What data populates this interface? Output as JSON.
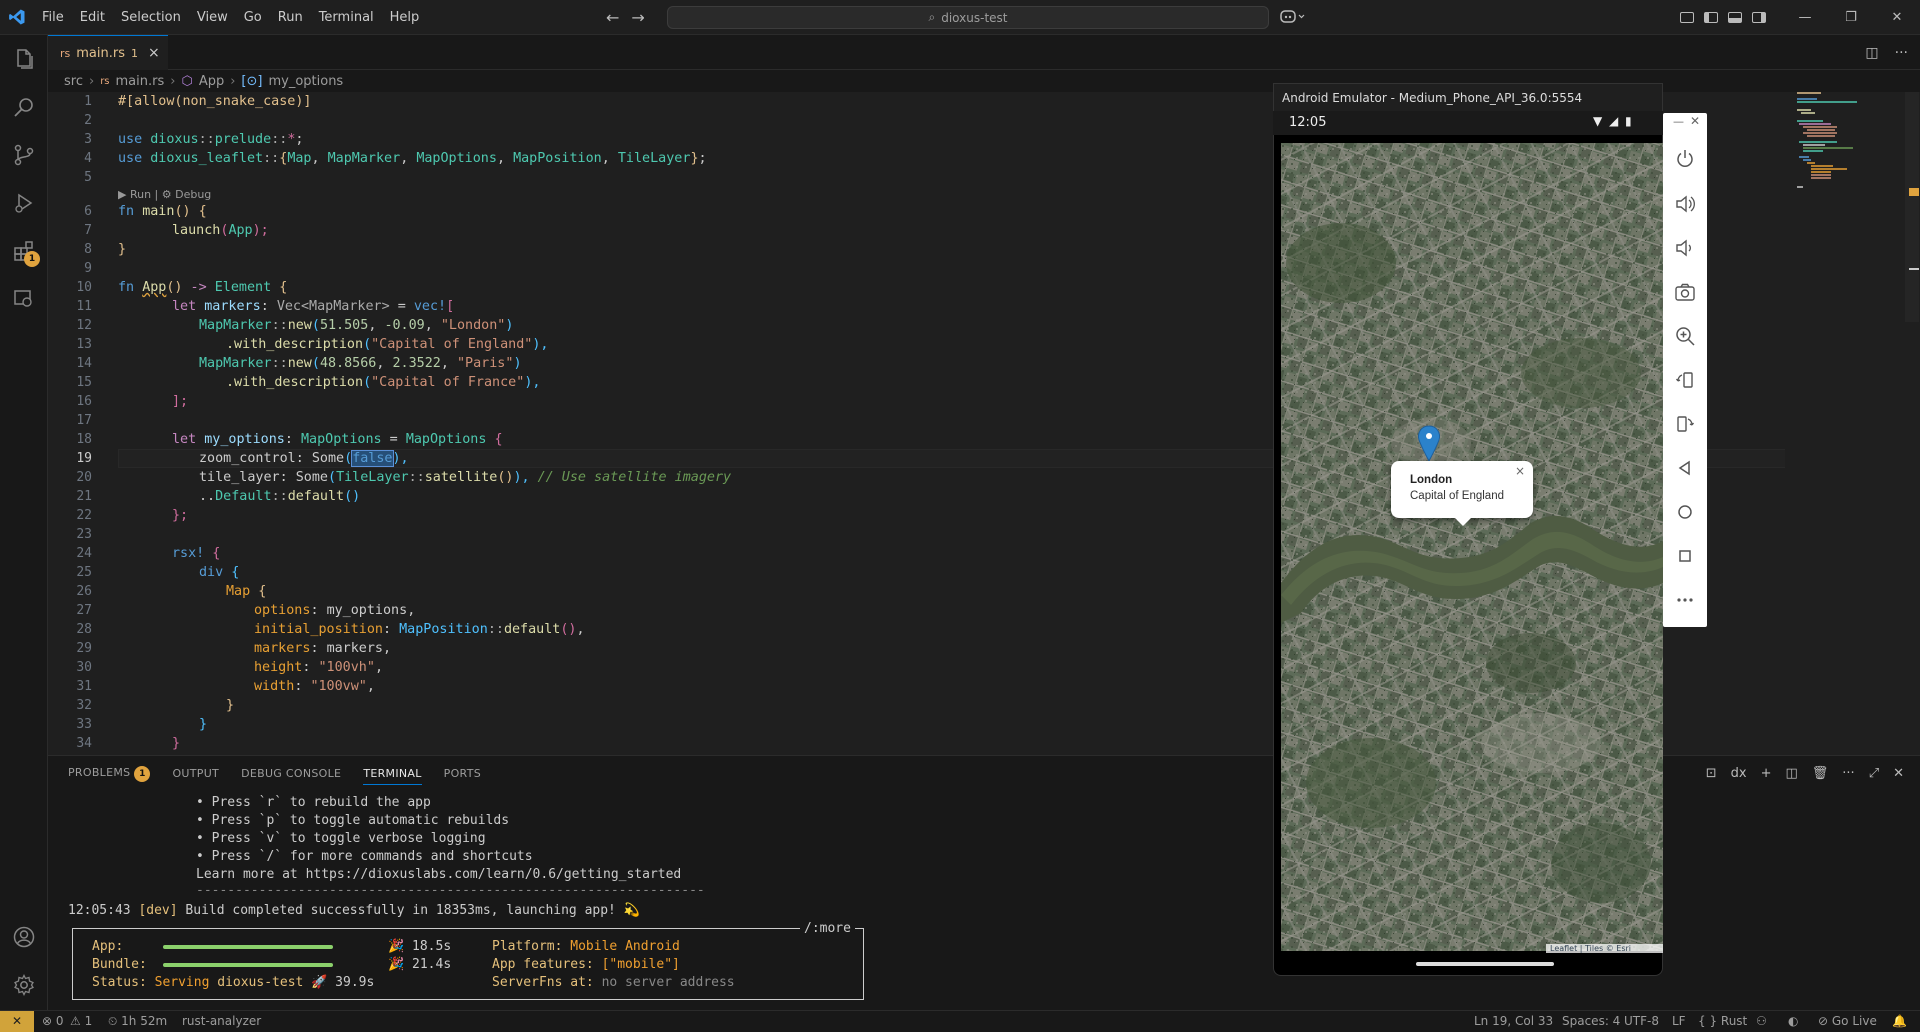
{
  "titlebar": {
    "menu": [
      "File",
      "Edit",
      "Selection",
      "View",
      "Go",
      "Run",
      "Terminal",
      "Help"
    ],
    "search": "dioxus-test"
  },
  "tab": {
    "icon_text": "rs",
    "name": "main.rs",
    "problems": "1",
    "close": "×"
  },
  "breadcrumb": [
    "src",
    "main.rs",
    "App",
    "my_options"
  ],
  "codelens": "▶ Run | ⚙ Debug",
  "line_numbers": [
    "1",
    "2",
    "3",
    "4",
    "5",
    "6",
    "7",
    "8",
    "9",
    "10",
    "11",
    "12",
    "13",
    "14",
    "15",
    "16",
    "17",
    "18",
    "19",
    "20",
    "21",
    "22",
    "23",
    "24",
    "25",
    "26",
    "27",
    "28",
    "29",
    "30",
    "31",
    "32",
    "33",
    "34"
  ],
  "code": {
    "l1": [
      "#[allow(non_snake_case)]"
    ],
    "l3": [
      "use",
      "dioxus",
      "::",
      "prelude",
      "::",
      "*",
      ";"
    ],
    "l4": [
      "use",
      "dioxus_leaflet",
      "::",
      "{",
      "Map",
      ", ",
      "MapMarker",
      ", ",
      "MapOptions",
      ", ",
      "MapPosition",
      ", ",
      "TileLayer",
      "}",
      ";"
    ],
    "l6": [
      "fn",
      "main",
      "()",
      " {"
    ],
    "l7": [
      "launch",
      "(",
      "App",
      ");"
    ],
    "l8": [
      "}"
    ],
    "l10": [
      "fn",
      "App",
      "()",
      " -> ",
      "Element",
      " {"
    ],
    "l11": [
      "let",
      "markers",
      ": ",
      "Vec<MapMarker>",
      " = ",
      "vec!",
      "["
    ],
    "l12": [
      "MapMarker",
      "::",
      "new",
      "(",
      "51.505",
      ", ",
      "-0.09",
      ", ",
      "\"London\"",
      ")"
    ],
    "l13": [
      ".with_description",
      "(",
      "\"Capital of England\"",
      "),"
    ],
    "l14": [
      "MapMarker",
      "::",
      "new",
      "(",
      "48.8566",
      ", ",
      "2.3522",
      ", ",
      "\"Paris\"",
      ")"
    ],
    "l15": [
      ".with_description",
      "(",
      "\"Capital of France\"",
      "),"
    ],
    "l16": [
      "];"
    ],
    "l18": [
      "let",
      "my_options",
      ": ",
      "MapOptions",
      " = ",
      "MapOptions",
      " {"
    ],
    "l19": [
      "zoom_control",
      ": ",
      "Some",
      "(",
      "false",
      "),"
    ],
    "l20": [
      "tile_layer",
      ": ",
      "Some",
      "(",
      "TileLayer",
      "::",
      "satellite",
      "()",
      "), ",
      "// Use satellite imagery"
    ],
    "l21": [
      "..",
      "Default",
      "::",
      "default",
      "()"
    ],
    "l22": [
      "};"
    ],
    "l24": [
      "rsx!",
      " {"
    ],
    "l25": [
      "div",
      " {"
    ],
    "l26": [
      "Map",
      " {"
    ],
    "l27": [
      "options",
      ": ",
      "my_options",
      ","
    ],
    "l28": [
      "initial_position",
      ": ",
      "MapPosition",
      "::",
      "default",
      "()",
      ","
    ],
    "l29": [
      "markers",
      ": ",
      "markers",
      ","
    ],
    "l30": [
      "height",
      ": ",
      "\"100vh\"",
      ","
    ],
    "l31": [
      "width",
      ": ",
      "\"100vw\"",
      ","
    ],
    "l32": [
      "}"
    ],
    "l33": [
      "}"
    ],
    "l34": [
      "}"
    ]
  },
  "panel": {
    "tabs": [
      "PROBLEMS",
      "OUTPUT",
      "DEBUG CONSOLE",
      "TERMINAL",
      "PORTS"
    ],
    "problems_count": "1",
    "terminal_name": "dx",
    "lines": [
      "• Press `r` to rebuild the app",
      "• Press `p` to toggle automatic rebuilds",
      "• Press `v` to toggle verbose logging",
      "• Press `/` for more commands and shortcuts",
      "Learn more at https://dioxuslabs.com/learn/0.6/getting_started",
      "-----------------------------------------------------------------"
    ],
    "build_time": "12:05:43",
    "build_tag": "[dev]",
    "build_msg": "Build completed successfully in 18353ms, launching app! 💫",
    "box_title": "/:more",
    "app_label": "App:",
    "app_time": "🎉 18.5s",
    "bundle_label": "Bundle:",
    "bundle_time": "🎉 21.4s",
    "status_label": "Status:",
    "status_serving": "Serving",
    "status_project": "dioxus-test",
    "status_time": "🚀 39.9s",
    "platform_label": "Platform:",
    "platform_value": "Mobile Android",
    "features_label": "App features:",
    "features_value": "[\"mobile\"]",
    "serverfns_label": "ServerFns at:",
    "serverfns_value": "no server address",
    "app_progress": 1.0,
    "bundle_progress": 1.0
  },
  "statusbar": {
    "remote": "✕",
    "errors": "⊗ 0",
    "warnings": "⚠ 1",
    "time": "⏲ 1h 52m",
    "analyzer": "rust-analyzer",
    "position": "Ln 19, Col 33",
    "spaces": "Spaces: 4",
    "encoding": "UTF-8",
    "eol": "LF",
    "language": "{ } Rust",
    "golive": "⊘ Go Live"
  },
  "emulator": {
    "title": "Android Emulator - Medium_Phone_API_36.0:5554",
    "clock": "12:05",
    "popup_title": "London",
    "popup_desc": "Capital of England",
    "popup_close": "×",
    "attribution": "Leaflet | Tiles © Esri"
  },
  "colors": {
    "accent": "#0078d4",
    "warning": "#e0a33e",
    "marker": "#2b82cb"
  }
}
